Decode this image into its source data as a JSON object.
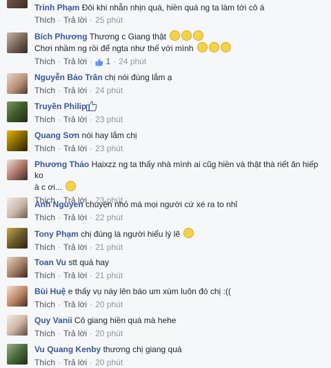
{
  "comments": [
    {
      "author": "Trinh Phạm",
      "text": "Đôi khi nhẫn nhịn quá, hiền quá ng ta làm tới cô á",
      "like": "Thích",
      "reply": "Trả lời",
      "time": "25 phút"
    },
    {
      "author": "Bích Phương",
      "text": "Thương c Giang thật",
      "text2": "Chơi nhầm ng rồi để ngta như thế với mình",
      "like": "Thích",
      "reply": "Trả lời",
      "likes": "1",
      "time": "24 phút"
    },
    {
      "author": "Nguyễn Bảo Trân",
      "text": "chị nói đúng lắm ạ",
      "like": "Thích",
      "reply": "Trả lời",
      "time": "24 phút"
    },
    {
      "author": "Truyền Philip",
      "text": "",
      "like": "Thích",
      "reply": "Trả lời",
      "time": "23 phút"
    },
    {
      "author": "Quang Sơn",
      "text": "nói hay lắm chị",
      "like": "Thích",
      "reply": "Trả lời",
      "time": "23 phút"
    },
    {
      "author": "Phương Thảo",
      "text": "Haixzz ng ta thấy nhà mình ai cũg hiền và thật thà riết ăn hiếp ko",
      "text2": "à c ơi...",
      "like": "Thích",
      "reply": "Trả lời",
      "time": "23 phút"
    },
    {
      "author": "Anh Nguyen",
      "text": "chuyện nhỏ mà mọi người cứ xé ra to nhỉ",
      "like": "Thích",
      "reply": "Trả lời",
      "time": "22 phút"
    },
    {
      "author": "Tony Phạm",
      "text": "chị đúng là người hiểu lý lẽ",
      "like": "Thích",
      "reply": "Trả lời",
      "time": "21 phút"
    },
    {
      "author": "Toan Vu",
      "text": "stt quá hay",
      "like": "Thích",
      "reply": "Trả lời",
      "time": "21 phút"
    },
    {
      "author": "Bùi Huệ",
      "text": "e thấy vụ này lên báo um xùm luôn đó chị :((",
      "like": "Thích",
      "reply": "Trả lời",
      "time": "20 phút"
    },
    {
      "author": "Quy Vanii",
      "text": "Cô giang hiền quá mà hehe",
      "like": "Thích",
      "reply": "Trả lời",
      "time": "20 phút"
    },
    {
      "author": "Vu Quang Kenby",
      "text": "thương chị giang quá",
      "like": "Thích",
      "reply": "Trả lời",
      "time": "20 phút"
    }
  ],
  "colors": {
    "author": "#365899",
    "meta": "#90949c",
    "background": "#f6f7f9"
  }
}
